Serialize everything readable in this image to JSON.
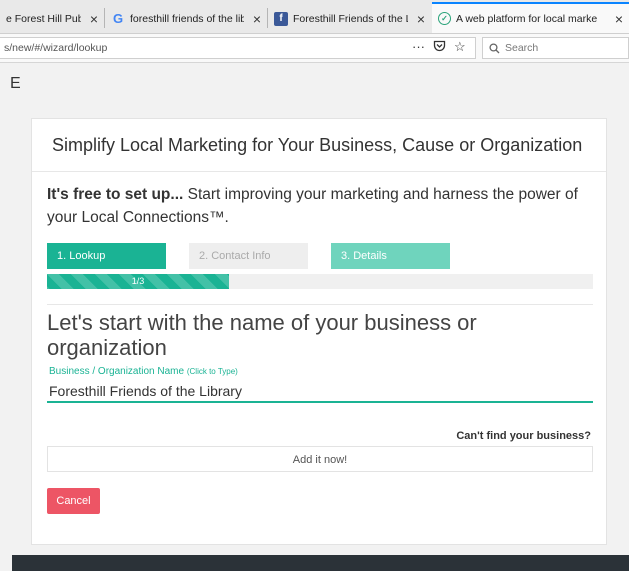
{
  "browser": {
    "tabs": [
      {
        "title": "e Forest Hill Pub",
        "icon": "none",
        "active": false
      },
      {
        "title": "foresthill friends of the library -",
        "icon": "google-icon",
        "active": false
      },
      {
        "title": "Foresthill Friends of the Library",
        "icon": "facebook-icon",
        "active": false
      },
      {
        "title": "A web platform for local marke",
        "icon": "site-icon",
        "active": true
      }
    ],
    "tab_close": "×",
    "url": "s/new/#/wizard/lookup",
    "search_placeholder": "Search"
  },
  "page": {
    "site_letter": "E",
    "card_title": "Simplify Local Marketing for Your Business, Cause or Organization",
    "intro_bold": "It's free to set up...",
    "intro_text": " Start improving your marketing and harness the power of your Local Connections™.",
    "steps": [
      {
        "label": "1. Lookup",
        "state": "active"
      },
      {
        "label": "2. Contact Info",
        "state": "pending"
      },
      {
        "label": "3. Details",
        "state": "pending"
      }
    ],
    "progress": {
      "label": "1/3",
      "fraction": 0.3333
    },
    "question": "Let's start with the name of your business or organization",
    "field_label": "Business / Organization Name",
    "field_hint": "(Click to Type)",
    "field_value": "Foresthill Friends of the Library",
    "cant_find": "Can't find your business?",
    "add_label": "Add it now!",
    "cancel_label": "Cancel"
  },
  "colors": {
    "accent": "#1ab394",
    "step_light": "#6fd4bd",
    "danger": "#ed5565",
    "footer": "#2b3238"
  }
}
